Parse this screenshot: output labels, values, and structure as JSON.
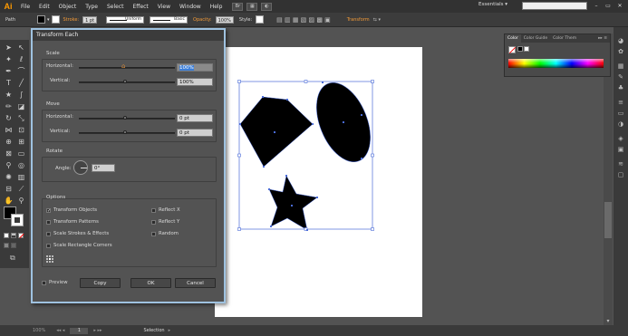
{
  "app": {
    "logo": "Ai"
  },
  "menu": [
    "File",
    "Edit",
    "Object",
    "Type",
    "Select",
    "Effect",
    "View",
    "Window",
    "Help"
  ],
  "workspace": {
    "label": "Essentials",
    "dropdown": "▾"
  },
  "search": {
    "placeholder": ""
  },
  "control_bar": {
    "object_label": "Path",
    "stroke_label": "Stroke:",
    "stroke_weight": "1 pt",
    "uniform_label": "Uniform",
    "basic_label": "Basic",
    "opacity_label": "Opacity:",
    "opacity_value": "100%",
    "style_label": "Style:",
    "transform_label": "Transform"
  },
  "dialog": {
    "title": "Transform Each",
    "scale": {
      "title": "Scale",
      "horizontal_label": "Horizontal:",
      "horizontal_value": "100%",
      "vertical_label": "Vertical:",
      "vertical_value": "100%"
    },
    "move": {
      "title": "Move",
      "horizontal_label": "Horizontal:",
      "horizontal_value": "0 pt",
      "vertical_label": "Vertical:",
      "vertical_value": "0 pt"
    },
    "rotate": {
      "title": "Rotate",
      "angle_label": "Angle:",
      "angle_value": "0°"
    },
    "options": {
      "title": "Options",
      "transform_objects": {
        "label": "Transform Objects",
        "checked": true
      },
      "transform_patterns": {
        "label": "Transform Patterns",
        "checked": false
      },
      "scale_strokes": {
        "label": "Scale Strokes & Effects",
        "checked": false
      },
      "scale_rect_corners": {
        "label": "Scale Rectangle Corners",
        "checked": false
      },
      "reflect_x": {
        "label": "Reflect X",
        "checked": false
      },
      "reflect_y": {
        "label": "Reflect Y",
        "checked": false
      },
      "random": {
        "label": "Random",
        "checked": false
      }
    },
    "preview_label": "Preview",
    "copy_label": "Copy",
    "ok_label": "OK",
    "cancel_label": "Cancel"
  },
  "color_panel": {
    "tabs": [
      "Color",
      "Color Guide",
      "Color Them"
    ]
  },
  "status": {
    "zoom": "100%",
    "page": "1",
    "tool": "Selection"
  },
  "colors": {
    "selection_blue": "#4a6bd8",
    "accent_orange": "#f29a38",
    "dialog_border": "#9fc2e0"
  }
}
